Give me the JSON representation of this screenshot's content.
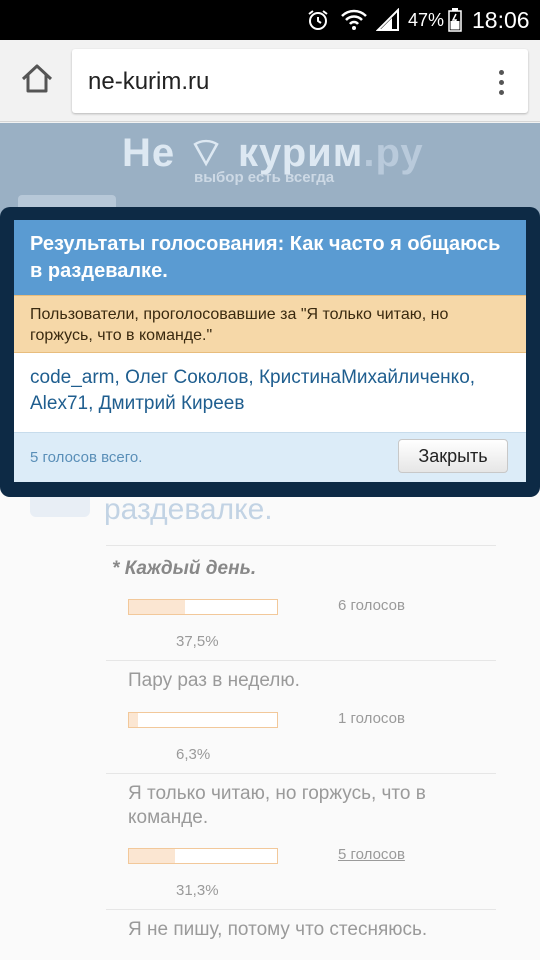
{
  "status_bar": {
    "battery_percent": "47%",
    "time": "18:06",
    "icons": [
      "alarm-icon",
      "wifi-icon",
      "signal-icon",
      "battery-icon"
    ]
  },
  "browser": {
    "url": "ne-kurim.ru",
    "icons": [
      "home-icon",
      "menu-icon"
    ]
  },
  "site": {
    "logo_main": "Не",
    "logo_word": "курим",
    "logo_tld": ".ру",
    "tagline": "выбор есть всегда"
  },
  "poll": {
    "question_tail": "раздевалке.",
    "options": [
      {
        "text": "Каждый день.",
        "votes": "6 голосов",
        "percent": "37,5%",
        "fill": 0.375,
        "selected": true
      },
      {
        "text": "Пару раз в неделю.",
        "votes": "1 голосов",
        "percent": "6,3%",
        "fill": 0.063
      },
      {
        "text": "Я только читаю, но горжусь, что в команде.",
        "votes": "5 голосов",
        "percent": "31,3%",
        "fill": 0.313
      },
      {
        "text": "Я не пишу, потому что стесняюсь."
      }
    ],
    "selected_marker": "*"
  },
  "dialog": {
    "title": "Результаты голосования: Как часто я общаюсь в раздевалке.",
    "notice": "Пользователи, проголосовавшие за \"Я только читаю, но горжусь, что в команде.\"",
    "users": [
      "code_arm",
      "Олег Соколов",
      "КристинаМихайличенко",
      "Alex71",
      "Дмитрий Киреев"
    ],
    "separator": ", ",
    "total": "5 голосов всего.",
    "close_label": "Закрыть"
  },
  "colors": {
    "dialog_title_bg": "#5a9bd2",
    "notice_bg": "#f6d8a8",
    "link": "#1f5e8f",
    "overlay_frame": "#0d2a45"
  }
}
